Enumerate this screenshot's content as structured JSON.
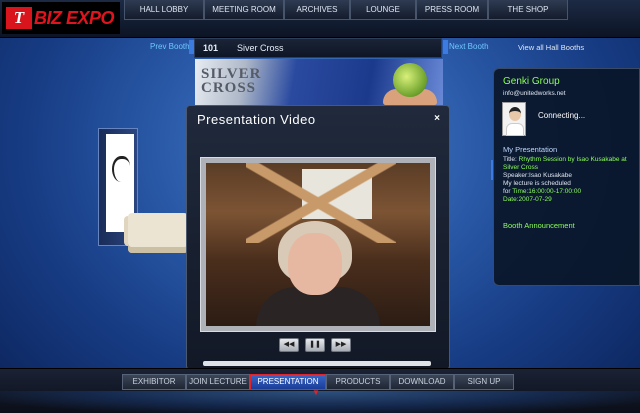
{
  "app": {
    "logo_mark": "T",
    "logo_text": "BIZ EXPO"
  },
  "top_nav": [
    {
      "label": "HALL LOBBY"
    },
    {
      "label": "MEETING ROOM"
    },
    {
      "label": "ARCHIVES"
    },
    {
      "label": "LOUNGE"
    },
    {
      "label": "PRESS ROOM"
    },
    {
      "label": "THE SHOP"
    }
  ],
  "booth": {
    "prev_label": "Prev Booth",
    "number": "101",
    "name": "Siver Cross",
    "next_label": "Next Booth",
    "view_all_label": "View all Hall Booths",
    "banner_text_line1": "SILVER",
    "banner_text_line2": "CROSS"
  },
  "info_panel": {
    "company": "Genki Group",
    "email": "info@unitedworks.net",
    "status": "Connecting...",
    "my_presentation_heading": "My Presentation",
    "title_prefix": "Title: ",
    "title": "Rhythm Session by Isao Kusakabe at Silver Cross",
    "speaker": "Speaker:Isao Kusakabe",
    "note": "My lecture is scheduled",
    "time_prefix": "for ",
    "time": "Time:16:00:00-17:00:00",
    "date": " Date:2007-07-29",
    "booth_announcement": "Booth Announcement"
  },
  "modal": {
    "title": "Presentation Video",
    "close_glyph": "×",
    "controls": {
      "rewind_glyph": "◀◀",
      "pause_glyph": "❚❚",
      "forward_glyph": "▶▶"
    },
    "progress": 0
  },
  "bottom_nav": [
    {
      "label": "EXHIBITOR",
      "active": false
    },
    {
      "label": "JOIN LECTURE",
      "active": false
    },
    {
      "label": "PRESENTATION",
      "active": true
    },
    {
      "label": "PRODUCTS",
      "active": false
    },
    {
      "label": "DOWNLOAD",
      "active": false
    },
    {
      "label": "SIGN UP",
      "active": false
    }
  ],
  "colors": {
    "accent": "#e0242c",
    "highlight_green": "#8cff5a",
    "link_blue": "#6fc7ff"
  }
}
